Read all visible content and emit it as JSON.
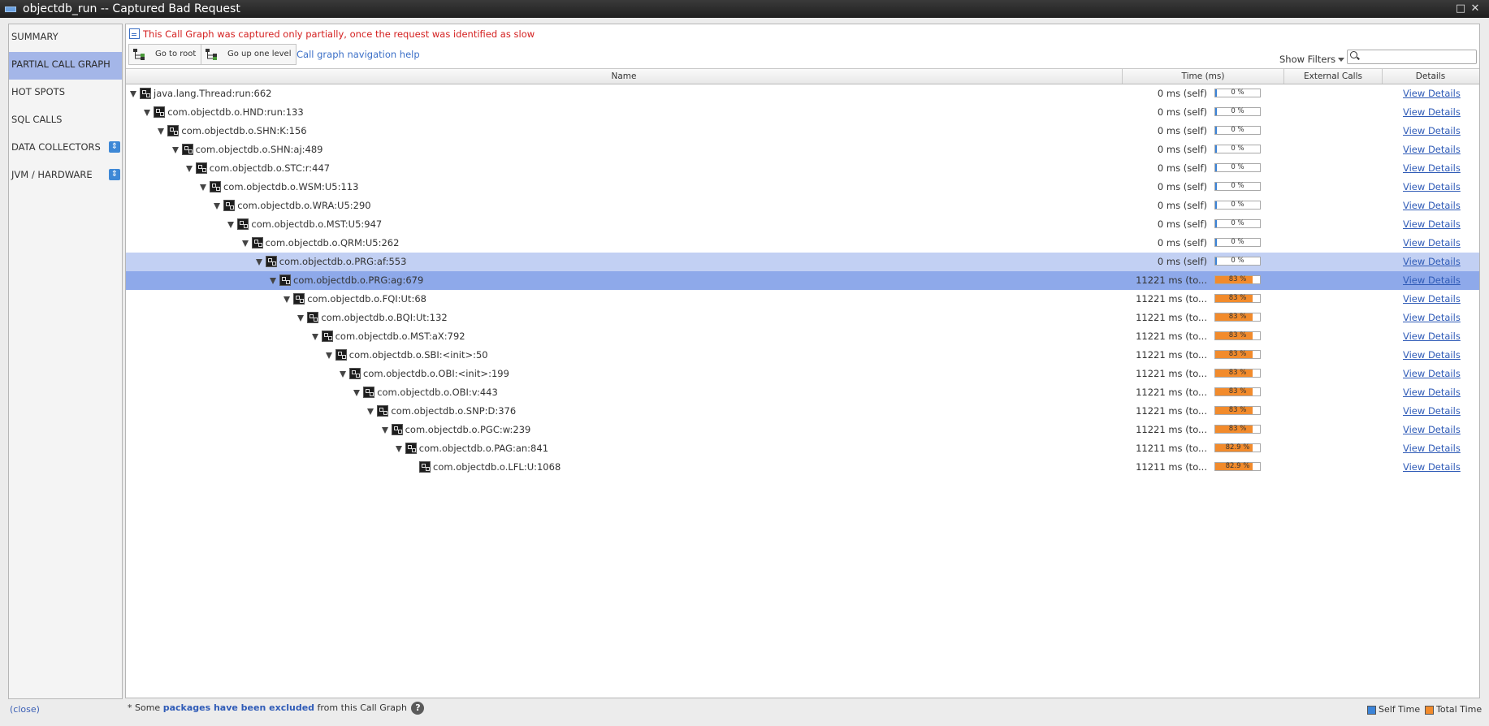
{
  "window": {
    "title": "objectdb_run -- Captured Bad Request",
    "maximize_glyph": "□",
    "close_glyph": "✕"
  },
  "colors": {
    "nav_active": "#a4b6e8",
    "self_time": "#3c84d8",
    "total_time": "#f28b2c",
    "warning_text": "#d42020",
    "link": "#2f5bb7"
  },
  "sidebar": {
    "items": [
      {
        "label": "SUMMARY",
        "active": false,
        "badge": false
      },
      {
        "label": "PARTIAL CALL GRAPH",
        "active": true,
        "badge": false
      },
      {
        "label": "HOT SPOTS",
        "active": false,
        "badge": false
      },
      {
        "label": "SQL CALLS",
        "active": false,
        "badge": false
      },
      {
        "label": "DATA COLLECTORS",
        "active": false,
        "badge": true
      },
      {
        "label": "JVM / HARDWARE",
        "active": false,
        "badge": true
      }
    ],
    "badge_icon": "expand-icon",
    "close_label": "(close)"
  },
  "main": {
    "warning": "This Call Graph was captured only partially, once the request was identified as slow",
    "go_root_label": "Go to root",
    "go_up_label": "Go up one level",
    "help_link": "Call graph navigation help",
    "show_filters": "Show Filters",
    "filter_value": ""
  },
  "table": {
    "headers": {
      "name": "Name",
      "time": "Time (ms)",
      "external": "External Calls",
      "details": "Details"
    },
    "view_details_label": "View Details",
    "rows": [
      {
        "name": "java.lang.Thread:run:662",
        "time": "0 ms (self)",
        "pct": "0 %",
        "fill": 0,
        "expandable": true,
        "state": ""
      },
      {
        "name": "com.objectdb.o.HND:run:133",
        "time": "0 ms (self)",
        "pct": "0 %",
        "fill": 0,
        "expandable": true,
        "state": ""
      },
      {
        "name": "com.objectdb.o.SHN:K:156",
        "time": "0 ms (self)",
        "pct": "0 %",
        "fill": 0,
        "expandable": true,
        "state": ""
      },
      {
        "name": "com.objectdb.o.SHN:aj:489",
        "time": "0 ms (self)",
        "pct": "0 %",
        "fill": 0,
        "expandable": true,
        "state": ""
      },
      {
        "name": "com.objectdb.o.STC:r:447",
        "time": "0 ms (self)",
        "pct": "0 %",
        "fill": 0,
        "expandable": true,
        "state": ""
      },
      {
        "name": "com.objectdb.o.WSM:U5:113",
        "time": "0 ms (self)",
        "pct": "0 %",
        "fill": 0,
        "expandable": true,
        "state": ""
      },
      {
        "name": "com.objectdb.o.WRA:U5:290",
        "time": "0 ms (self)",
        "pct": "0 %",
        "fill": 0,
        "expandable": true,
        "state": ""
      },
      {
        "name": "com.objectdb.o.MST:U5:947",
        "time": "0 ms (self)",
        "pct": "0 %",
        "fill": 0,
        "expandable": true,
        "state": ""
      },
      {
        "name": "com.objectdb.o.QRM:U5:262",
        "time": "0 ms (self)",
        "pct": "0 %",
        "fill": 0,
        "expandable": true,
        "state": ""
      },
      {
        "name": "com.objectdb.o.PRG:af:553",
        "time": "0 ms (self)",
        "pct": "0 %",
        "fill": 0,
        "expandable": true,
        "state": "sel-light"
      },
      {
        "name": "com.objectdb.o.PRG:ag:679",
        "time": "11221 ms (to...",
        "pct": "83 %",
        "fill": 0.83,
        "expandable": true,
        "state": "sel"
      },
      {
        "name": "com.objectdb.o.FQI:Ut:68",
        "time": "11221 ms (to...",
        "pct": "83 %",
        "fill": 0.83,
        "expandable": true,
        "state": ""
      },
      {
        "name": "com.objectdb.o.BQI:Ut:132",
        "time": "11221 ms (to...",
        "pct": "83 %",
        "fill": 0.83,
        "expandable": true,
        "state": ""
      },
      {
        "name": "com.objectdb.o.MST:aX:792",
        "time": "11221 ms (to...",
        "pct": "83 %",
        "fill": 0.83,
        "expandable": true,
        "state": ""
      },
      {
        "name": "com.objectdb.o.SBI:<init>:50",
        "time": "11221 ms (to...",
        "pct": "83 %",
        "fill": 0.83,
        "expandable": true,
        "state": ""
      },
      {
        "name": "com.objectdb.o.OBI:<init>:199",
        "time": "11221 ms (to...",
        "pct": "83 %",
        "fill": 0.83,
        "expandable": true,
        "state": ""
      },
      {
        "name": "com.objectdb.o.OBI:v:443",
        "time": "11221 ms (to...",
        "pct": "83 %",
        "fill": 0.83,
        "expandable": true,
        "state": ""
      },
      {
        "name": "com.objectdb.o.SNP:D:376",
        "time": "11221 ms (to...",
        "pct": "83 %",
        "fill": 0.83,
        "expandable": true,
        "state": ""
      },
      {
        "name": "com.objectdb.o.PGC:w:239",
        "time": "11221 ms (to...",
        "pct": "83 %",
        "fill": 0.83,
        "expandable": true,
        "state": ""
      },
      {
        "name": "com.objectdb.o.PAG:an:841",
        "time": "11211 ms (to...",
        "pct": "82.9 %",
        "fill": 0.829,
        "expandable": true,
        "state": ""
      },
      {
        "name": "com.objectdb.o.LFL:U:1068",
        "time": "11211 ms (to...",
        "pct": "82.9 %",
        "fill": 0.829,
        "expandable": false,
        "state": ""
      }
    ]
  },
  "footer": {
    "note_prefix": "* Some",
    "note_link": "packages have been excluded",
    "note_suffix": "from this Call Graph",
    "help_glyph": "?",
    "legend_self": "Self Time",
    "legend_total": "Total Time"
  }
}
